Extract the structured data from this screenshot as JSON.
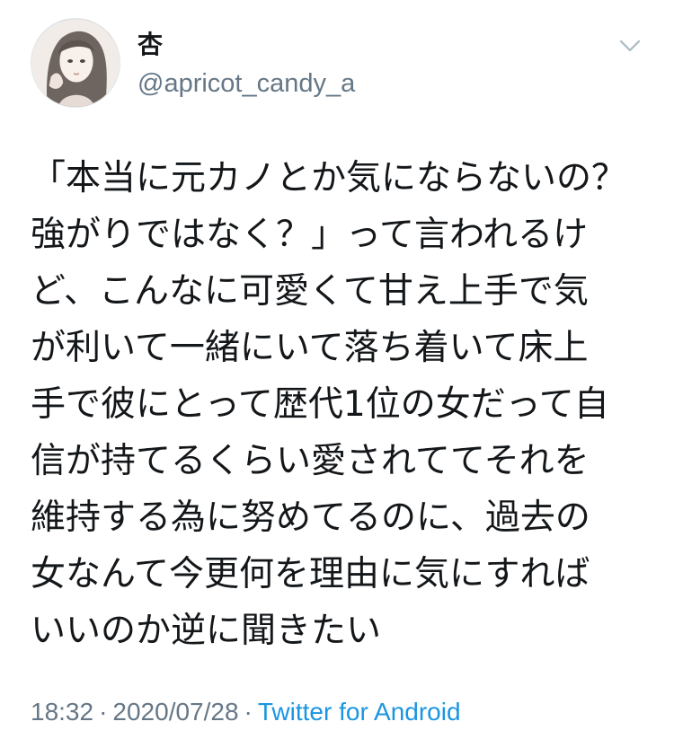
{
  "author": {
    "display_name": "杏",
    "handle": "@apricot_candy_a",
    "avatar_icon": "avatar-illustration"
  },
  "menu_icon": "chevron-down-icon",
  "tweet": {
    "lines": [
      "「本当に元カノとか気にならないの？",
      "強がりではなく？」って言われるけ",
      "ど、こんなに可愛くて甘え上手で気",
      "が利いて一緒にいて落ち着いて床上",
      "手で彼にとって歴代1位の女だって自",
      "信が持てるくらい愛されててそれを",
      "維持する為に努めてるのに、過去の",
      "女なんて今更何を理由に気にすれば",
      "いいのか逆に聞きたい"
    ]
  },
  "meta": {
    "time": "18:32",
    "separator": "·",
    "date": "2020/07/28",
    "source": "Twitter for Android"
  },
  "colors": {
    "text": "#14171a",
    "secondary": "#657786",
    "link": "#1b95e0"
  }
}
